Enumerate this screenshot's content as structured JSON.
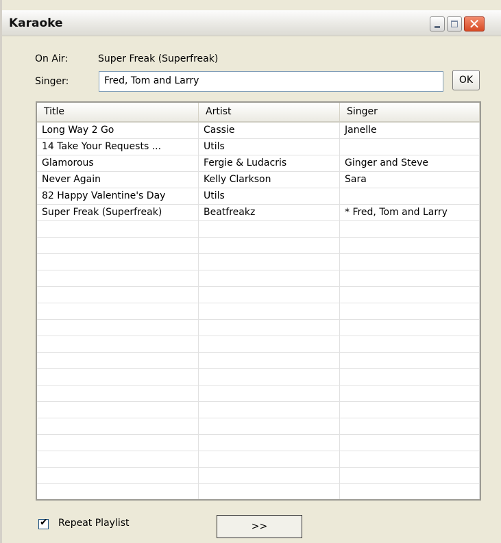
{
  "window": {
    "title": "Karaoke"
  },
  "now_playing": {
    "label": "On Air:",
    "value": "Super Freak (Superfreak)"
  },
  "singer": {
    "label": "Singer:",
    "value": "Fred, Tom and Larry",
    "ok_label": "OK"
  },
  "playlist": {
    "columns": [
      "Title",
      "Artist",
      "Singer"
    ],
    "rows": [
      {
        "title": "Long Way 2 Go",
        "artist": "Cassie",
        "singer": "Janelle"
      },
      {
        "title": "14 Take Your Requests ...",
        "artist": "Utils",
        "singer": ""
      },
      {
        "title": "Glamorous",
        "artist": "Fergie & Ludacris",
        "singer": "Ginger and Steve"
      },
      {
        "title": "Never Again",
        "artist": "Kelly Clarkson",
        "singer": "Sara"
      },
      {
        "title": "82 Happy Valentine's Day",
        "artist": "Utils",
        "singer": ""
      },
      {
        "title": "Super Freak (Superfreak)",
        "artist": "Beatfreakz",
        "singer": "* Fred, Tom and Larry"
      }
    ]
  },
  "footer": {
    "repeat_label": "Repeat Playlist",
    "repeat_checked": true,
    "next_label": ">>"
  }
}
